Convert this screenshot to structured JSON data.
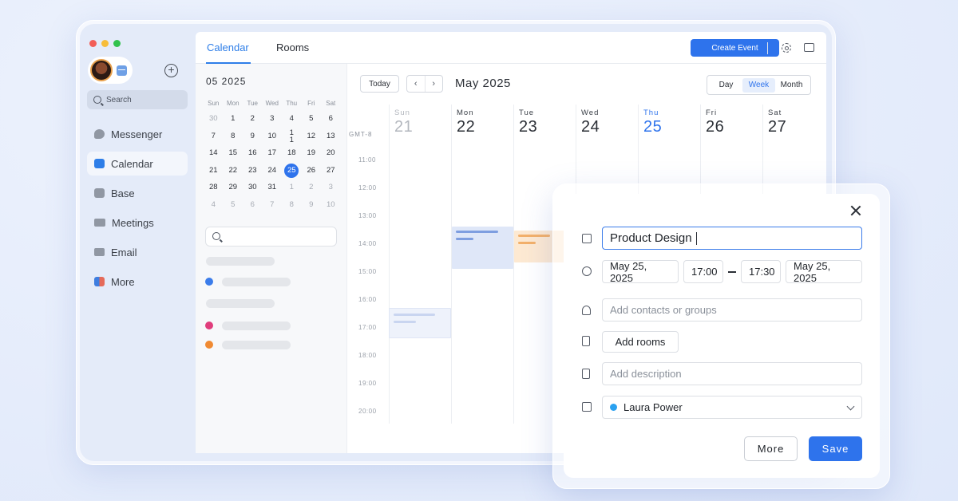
{
  "colors": {
    "accent": "#2e73ec",
    "event_blue": "#dfe7f8",
    "event_orange": "#fde9d2",
    "event_light_blue": "#d9effc",
    "dot_blue": "#3b7cea",
    "dot_pink": "#e03d7c",
    "dot_orange": "#f08a32",
    "calendar_dot": "#2aa1f0"
  },
  "nav": {
    "add_icon": "plus-circle-icon",
    "search_label": "Search",
    "items": [
      {
        "label": "Messenger",
        "icon": "chat-bubble-icon"
      },
      {
        "label": "Calendar",
        "icon": "calendar-icon",
        "active": true
      },
      {
        "label": "Base",
        "icon": "base-icon"
      },
      {
        "label": "Meetings",
        "icon": "video-icon"
      },
      {
        "label": "Email",
        "icon": "envelope-icon"
      },
      {
        "label": "More",
        "icon": "apps-grid-icon"
      }
    ]
  },
  "header": {
    "tabs": [
      "Calendar",
      "Rooms"
    ],
    "create_label": "Create Event",
    "settings_icon": "gear-icon",
    "popout_icon": "popout-icon"
  },
  "mini_calendar": {
    "title": "05 2025",
    "weekdays": [
      "Sun",
      "Mon",
      "Tue",
      "Wed",
      "Thu",
      "Fri",
      "Sat"
    ],
    "weeks": [
      [
        "30",
        "1",
        "2",
        "3",
        "4",
        "5",
        "6"
      ],
      [
        "7",
        "8",
        "9",
        "10",
        "1\n1",
        "12",
        "13"
      ],
      [
        "14",
        "15",
        "16",
        "17",
        "18",
        "19",
        "20"
      ],
      [
        "21",
        "22",
        "23",
        "24",
        "25",
        "26",
        "27"
      ],
      [
        "28",
        "29",
        "30",
        "31",
        "1",
        "2",
        "3"
      ],
      [
        "4",
        "5",
        "6",
        "7",
        "8",
        "9",
        "10"
      ]
    ],
    "selected": "25"
  },
  "week_view": {
    "today_label": "Today",
    "prev_glyph": "‹",
    "next_glyph": "›",
    "month_title": "May 2025",
    "views": [
      "Day",
      "Week",
      "Month"
    ],
    "active_view": "Week",
    "timezone": "GMT-8",
    "days": [
      {
        "name": "Sun",
        "num": "21"
      },
      {
        "name": "Mon",
        "num": "22"
      },
      {
        "name": "Tue",
        "num": "23"
      },
      {
        "name": "Wed",
        "num": "24"
      },
      {
        "name": "Thu",
        "num": "25"
      },
      {
        "name": "Fri",
        "num": "26"
      },
      {
        "name": "Sat",
        "num": "27"
      }
    ],
    "hours": [
      "11:00",
      "12:00",
      "13:00",
      "14:00",
      "15:00",
      "16:00",
      "17:00",
      "18:00",
      "19:00",
      "20:00"
    ]
  },
  "event_form": {
    "close_icon": "close-icon",
    "title_value": "Product Design",
    "start_date": "May 25, 2025",
    "start_time": "17:00",
    "end_time": "17:30",
    "end_date": "May 25, 2025",
    "contacts_placeholder": "Add contacts or groups",
    "rooms_label": "Add rooms",
    "description_placeholder": "Add description",
    "calendar_owner": "Laura Power",
    "more_label": "More",
    "save_label": "Save"
  }
}
